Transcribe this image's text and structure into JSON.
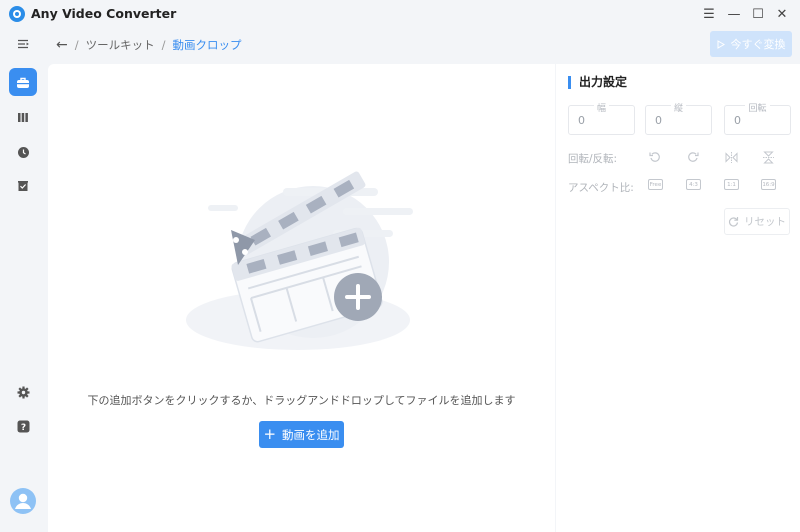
{
  "app": {
    "title": "Any Video Converter"
  },
  "window_controls": {
    "menu": "☰",
    "minimize": "—",
    "maximize": "☐",
    "close": "✕"
  },
  "breadcrumb": {
    "back": "←",
    "sep": "/",
    "section": "ツールキット",
    "current": "動画クロップ"
  },
  "toolbar": {
    "convert_label": "今すぐ変換"
  },
  "main": {
    "hint": "下の追加ボタンをクリックするか、ドラッグアンドドロップしてファイルを追加します",
    "add_button": "動画を追加",
    "add_icon": "+"
  },
  "settings": {
    "title": "出力設定",
    "width": {
      "label": "幅",
      "value": "0"
    },
    "height": {
      "label": "縦",
      "value": "0"
    },
    "rotation": {
      "label": "回転",
      "value": "0"
    },
    "rotate_flip_label": "回転/反転:",
    "aspect_label": "アスペクト比:",
    "aspect_options": [
      "Free",
      "4:3",
      "1:1",
      "16:9"
    ],
    "reset_label": "リセット"
  },
  "colors": {
    "accent": "#3a8ef0",
    "sidebar_bg": "#f3f5f8"
  }
}
